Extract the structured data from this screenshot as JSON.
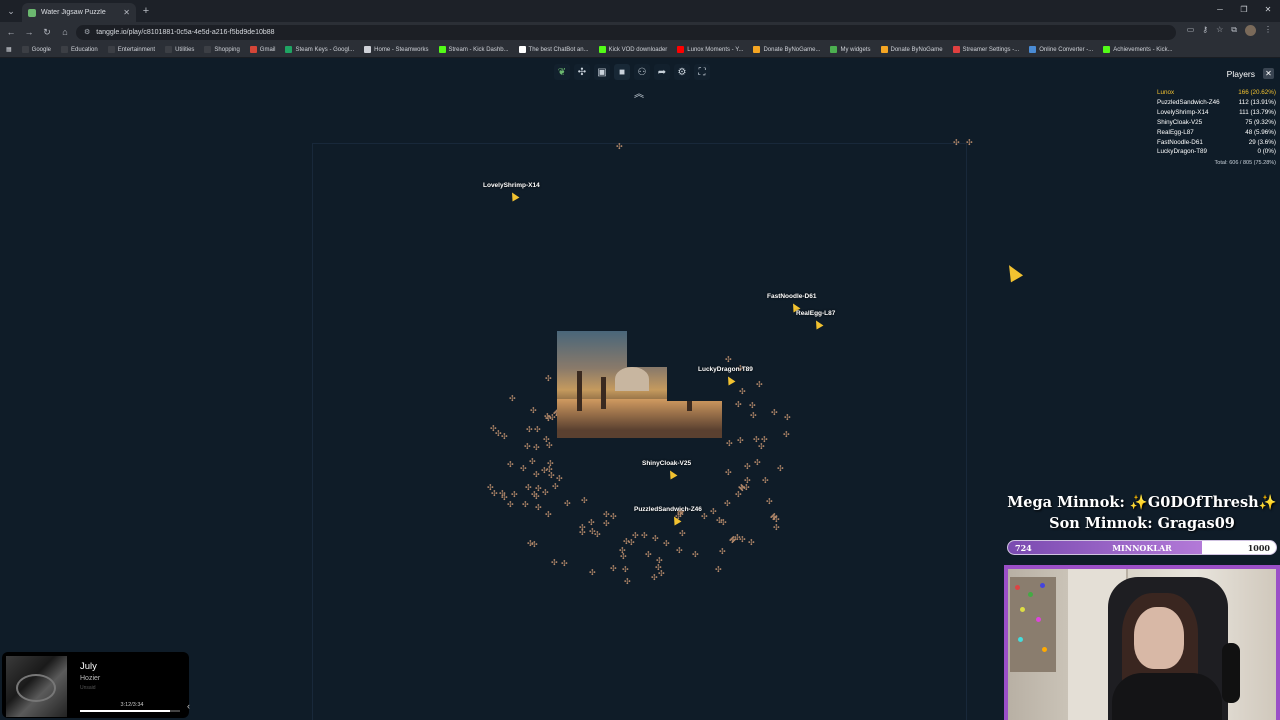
{
  "browser": {
    "tab_title": "Water Jigsaw Puzzle",
    "url": "tanggle.io/play/c8101881-0c5a-4e5d-a216-f5bd9de10b88",
    "bookmarks": [
      {
        "label": "Google",
        "color": "#3c3f45"
      },
      {
        "label": "Education",
        "color": "#3c3f45"
      },
      {
        "label": "Entertainment",
        "color": "#3c3f45"
      },
      {
        "label": "Utilities",
        "color": "#3c3f45"
      },
      {
        "label": "Shopping",
        "color": "#3c3f45"
      },
      {
        "label": "Gmail",
        "color": "#d44638"
      },
      {
        "label": "Steam Keys - Googl...",
        "color": "#1fa463"
      },
      {
        "label": "Home - Steamworks",
        "color": "#cfd2d8"
      },
      {
        "label": "Stream - Kick Dashb...",
        "color": "#53fc18"
      },
      {
        "label": "The best ChatBot an...",
        "color": "#ffffff"
      },
      {
        "label": "Kick VOD downloader",
        "color": "#53fc18"
      },
      {
        "label": "Lunox Moments - Y...",
        "color": "#ff0000"
      },
      {
        "label": "Donate ByNoGame...",
        "color": "#f5a623"
      },
      {
        "label": "My widgets",
        "color": "#4caf50"
      },
      {
        "label": "Donate ByNoGame",
        "color": "#f5a623"
      },
      {
        "label": "Streamer Settings -...",
        "color": "#e04040"
      },
      {
        "label": "Online Converter -...",
        "color": "#4a8bd4"
      },
      {
        "label": "Achievements - Kick...",
        "color": "#53fc18"
      }
    ]
  },
  "game": {
    "cursors": [
      {
        "name": "LovelyShrimp-X14"
      },
      {
        "name": "FastNoodle-D61"
      },
      {
        "name": "RealEgg-L87"
      },
      {
        "name": "LuckyDragon-T89"
      },
      {
        "name": "ShinyCloak-V25"
      },
      {
        "name": "PuzzledSandwich-Z46"
      }
    ]
  },
  "players": {
    "title": "Players",
    "rows": [
      {
        "name": "Lunox",
        "score": "166 (20.62%)"
      },
      {
        "name": "PuzzledSandwich-Z46",
        "score": "112 (13.91%)"
      },
      {
        "name": "LovelyShrimp-X14",
        "score": "111 (13.79%)"
      },
      {
        "name": "ShinyCloak-V25",
        "score": "75 (9.32%)"
      },
      {
        "name": "RealEgg-L87",
        "score": "48 (5.96%)"
      },
      {
        "name": "FastNoodle-D61",
        "score": "29 (3.6%)"
      },
      {
        "name": "LuckyDragon-T89",
        "score": "0 (0%)"
      }
    ],
    "total": "Total: 606 / 805 (75.28%)"
  },
  "overlay": {
    "mega": "Mega Minnok: ✨G0DOfThresh✨",
    "son": "Son Minnok: Gragas09",
    "bar_value": "724",
    "bar_label": "MINNOKLAR",
    "bar_max": "1000",
    "bar_fraction": 0.724
  },
  "music": {
    "song": "July",
    "artist": "Hozier",
    "extra": "Unsaid",
    "time": "3:12/3:34",
    "progress": 0.9
  },
  "colors": {
    "background": "#0f1b27",
    "cursor": "#f2c230",
    "leader": "#f2c230",
    "overlay_purple": "#9b4fc7"
  }
}
